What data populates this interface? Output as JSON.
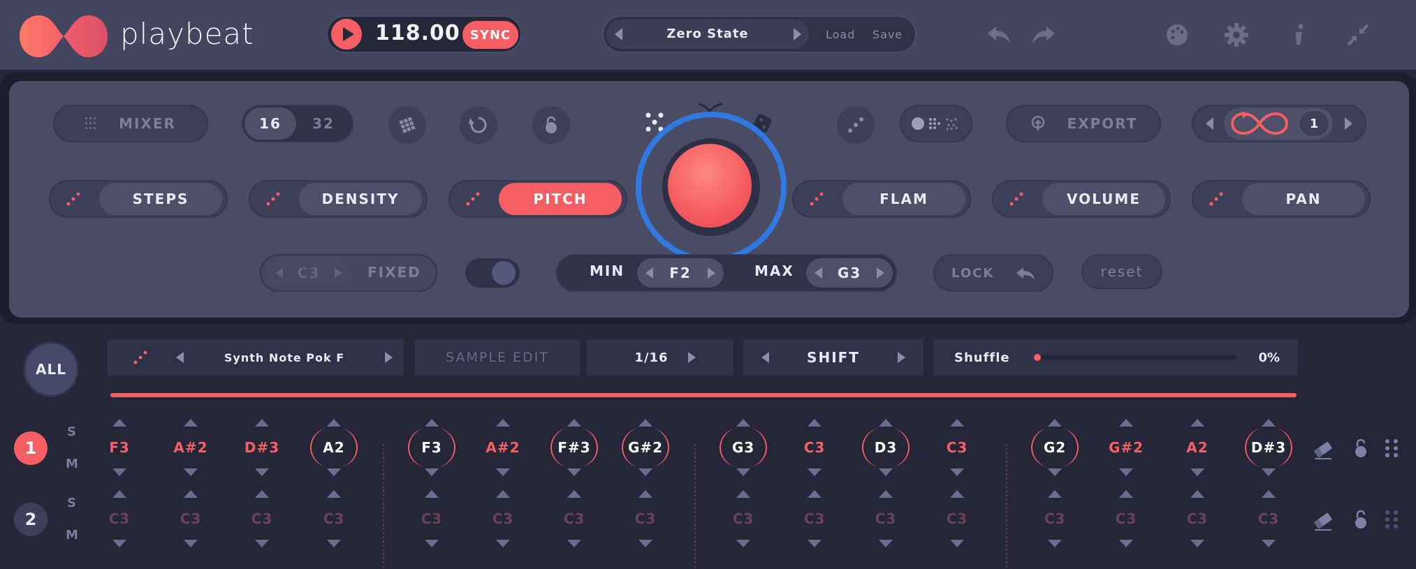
{
  "header": {
    "brand": "playbeat",
    "tempo": "118.00",
    "sync_label": "SYNC",
    "preset_name": "Zero State",
    "load_label": "Load",
    "save_label": "Save"
  },
  "panel": {
    "mixer_label": "MIXER",
    "steps_options": [
      "16",
      "32"
    ],
    "export_label": "EXPORT",
    "loop_count": "1",
    "modes": [
      "STEPS",
      "DENSITY",
      "PITCH",
      "FLAM",
      "VOLUME",
      "PAN"
    ],
    "active_mode": "PITCH",
    "fixed_note": "C3",
    "fixed_label": "FIXED",
    "min_label": "MIN",
    "min_value": "F2",
    "max_label": "MAX",
    "max_value": "G3",
    "lock_label": "LOCK",
    "reset_label": "reset"
  },
  "sequencer": {
    "all_label": "ALL",
    "sample_name": "Synth Note Pok F",
    "sample_edit_label": "SAMPLE EDIT",
    "division": "1/16",
    "shift_label": "SHIFT",
    "shuffle_label": "Shuffle",
    "shuffle_value": "0%",
    "solo_label": "S",
    "mute_label": "M",
    "tracks": [
      {
        "number": "1",
        "notes": [
          "F3",
          "A#2",
          "D#3",
          "A2",
          "F3",
          "A#2",
          "F#3",
          "G#2",
          "G3",
          "C3",
          "D3",
          "C3",
          "G2",
          "G#2",
          "A2",
          "D#3"
        ]
      },
      {
        "number": "2",
        "notes": [
          "C3",
          "C3",
          "C3",
          "C3",
          "C3",
          "C3",
          "C3",
          "C3",
          "C3",
          "C3",
          "C3",
          "C3",
          "C3",
          "C3",
          "C3",
          "C3"
        ]
      }
    ]
  },
  "colors": {
    "accent": "#f55e62",
    "ring": "#2f79e0",
    "panel": "#4a4c66",
    "background": "#252739"
  }
}
